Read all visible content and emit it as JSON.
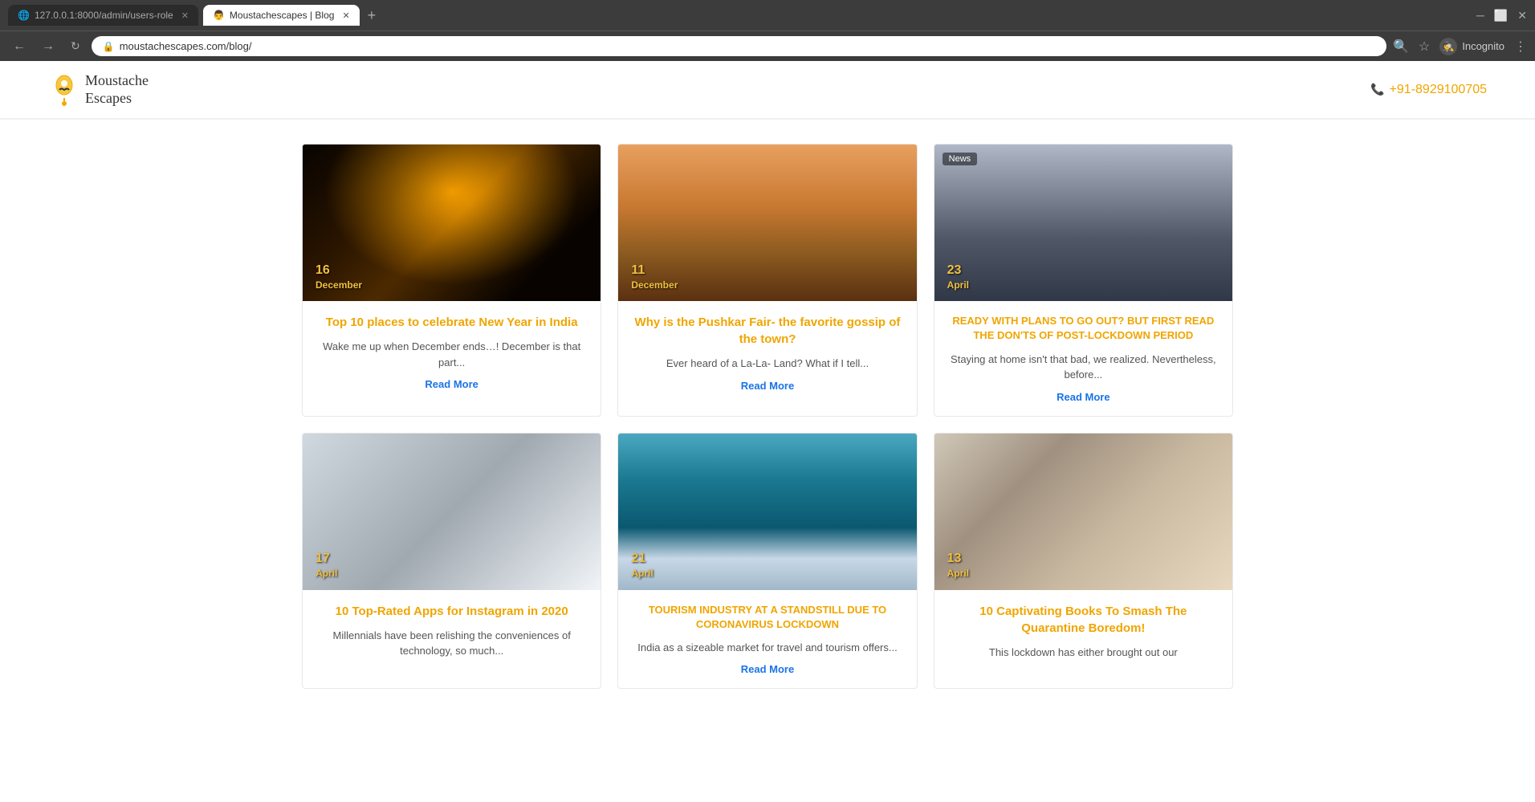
{
  "browser": {
    "tabs": [
      {
        "id": "tab1",
        "label": "127.0.0.1:8000/admin/users-role",
        "active": false,
        "icon": "globe"
      },
      {
        "id": "tab2",
        "label": "Moustachescapes | Blog",
        "active": true,
        "icon": "mustache"
      }
    ],
    "url": "moustachescapes.com/blog/",
    "incognito_label": "Incognito"
  },
  "site": {
    "logo_text_line1": "Moustache",
    "logo_text_line2": "Escapes",
    "phone": "+91-8929100705"
  },
  "blog": {
    "cards": [
      {
        "id": "card1",
        "day": "16",
        "month": "December",
        "image_class": "img-concert",
        "title": "Top 10 places to celebrate New Year in India",
        "excerpt": "Wake me up when December ends…! December is that part...",
        "read_more": "Read More",
        "news_badge": false,
        "title_case": "title"
      },
      {
        "id": "card2",
        "day": "11",
        "month": "December",
        "image_class": "img-pushkar",
        "title": "Why is the Pushkar Fair- the favorite gossip of the town?",
        "excerpt": "Ever heard of a La-La- Land? What if I tell...",
        "read_more": "Read More",
        "news_badge": false,
        "title_case": "title"
      },
      {
        "id": "card3",
        "day": "23",
        "month": "April",
        "image_class": "img-city",
        "title": "READY WITH PLANS TO GO OUT? BUT FIRST READ THE DON'TS OF POST-LOCKDOWN PERIOD",
        "excerpt": "Staying at home isn't that bad, we realized. Nevertheless, before...",
        "read_more": "Read More",
        "news_badge": true,
        "news_badge_text": "News",
        "title_case": "upper"
      },
      {
        "id": "card4",
        "day": "17",
        "month": "April",
        "image_class": "img-phone",
        "title": "10 Top-Rated Apps for Instagram in 2020",
        "excerpt": "Millennials have been relishing the conveniences of technology, so much...",
        "read_more": null,
        "news_badge": false,
        "title_case": "title"
      },
      {
        "id": "card5",
        "day": "21",
        "month": "April",
        "image_class": "img-aerial",
        "title": "TOURISM INDUSTRY AT A STANDSTILL DUE TO CORONAVIRUS LOCKDOWN",
        "excerpt": "India as a sizeable market for travel and tourism offers...",
        "read_more": "Read More",
        "news_badge": false,
        "title_case": "upper"
      },
      {
        "id": "card6",
        "day": "13",
        "month": "April",
        "image_class": "img-books",
        "title": "10 Captivating Books To Smash The Quarantine Boredom!",
        "excerpt": "This lockdown has either brought out our",
        "read_more": null,
        "news_badge": false,
        "title_case": "title"
      }
    ]
  }
}
